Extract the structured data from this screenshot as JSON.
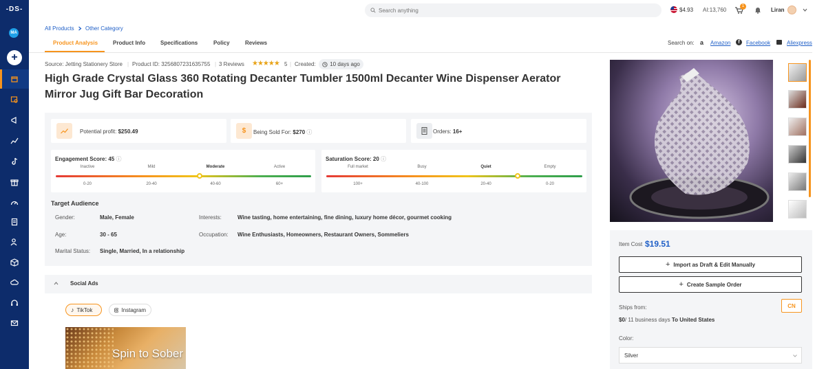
{
  "sidebar": {
    "logo": "-DS-",
    "avatar": "MA",
    "add_label": "+",
    "icons": [
      "store-icon",
      "product-search-icon",
      "megaphone-icon",
      "chart-icon",
      "tiktok-icon",
      "gift-icon",
      "gauge-icon",
      "clipboard-icon",
      "user-star-icon",
      "box-icon",
      "cloud-upload-icon",
      "headset-icon",
      "mail-icon"
    ]
  },
  "topbar": {
    "search_placeholder": "Search anything",
    "balance": "$4.93",
    "ai_credits": "AI:13,760",
    "cart_count": "1",
    "user_name": "Liran"
  },
  "breadcrumb": [
    "All Products",
    "Other Category"
  ],
  "tabs": [
    "Product Analysis",
    "Product Info",
    "Specifications",
    "Policy",
    "Reviews"
  ],
  "search_on": {
    "label": "Search on:",
    "links": [
      "Amazon",
      "Facebook",
      "Aliexpress"
    ]
  },
  "meta": {
    "source": "Source: Jetting Stationery Store",
    "product_id": "Product ID: 3256807231635755",
    "reviews": "3 Reviews",
    "rating": "5",
    "created_label": "Created:",
    "created_value": "10 days ago"
  },
  "title": "High Grade Crystal Glass 360 Rotating Decanter Tumbler 1500ml Decanter Wine Dispenser Aerator Mirror Jug Gift Bar Decoration",
  "stats": {
    "profit_label": "Potential profit:",
    "profit_value": "$250.49",
    "sold_label": "Being Sold For:",
    "sold_value": "$270",
    "orders_label": "Orders:",
    "orders_value": "16+"
  },
  "engagement": {
    "title": "Engagement Score: 45",
    "levels": [
      "Inactive",
      "Mild",
      "Moderate",
      "Active"
    ],
    "ranges": [
      "0-20",
      "20-40",
      "40-60",
      "60+"
    ],
    "score": 45
  },
  "saturation": {
    "title": "Saturation Score: 20",
    "levels": [
      "Full market",
      "Busy",
      "Quiet",
      "Empty"
    ],
    "ranges": [
      "100+",
      "40-100",
      "20-40",
      "0-20"
    ],
    "score": 20
  },
  "audience": {
    "title": "Target Audience",
    "gender_label": "Gender:",
    "gender": "Male, Female",
    "age_label": "Age:",
    "age": "30 - 65",
    "marital_label": "Marital Status:",
    "marital": "Single, Married, In a relationship",
    "interests_label": "Interests:",
    "interests": "Wine tasting, home entertaining, fine dining, luxury home décor, gourmet cooking",
    "occupation_label": "Occupation:",
    "occupation": "Wine Enthusiasts, Homeowners, Restaurant Owners, Sommeliers"
  },
  "social_ads": {
    "title": "Social Ads",
    "platforms": [
      "TikTok",
      "Instagram"
    ],
    "video_caption": "Spin to Sober"
  },
  "pricing": {
    "item_cost_label": "Item Cost",
    "item_cost": "$19.51",
    "import_button": "Import as Draft & Edit Manually",
    "sample_button": "Create Sample Order",
    "ships_from_label": "Ships from:",
    "ships_from": "CN",
    "shipping_cost": "$0",
    "shipping_time": "/ 11 business days",
    "shipping_to": "To United States",
    "color_label": "Color:",
    "color_value": "Silver"
  },
  "colors": {
    "brand_navy": "#0d2c6b",
    "accent_orange": "#f7941d",
    "link_blue": "#1f5fc7"
  }
}
